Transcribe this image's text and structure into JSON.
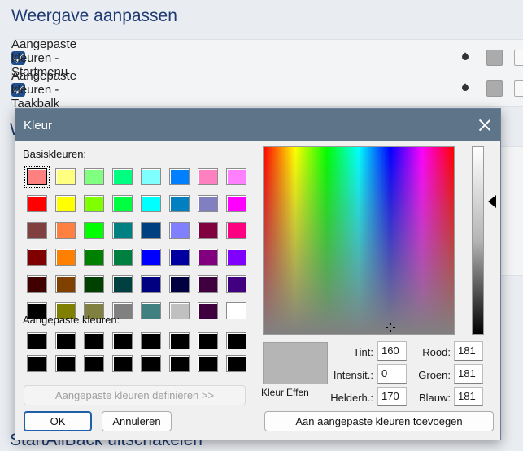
{
  "background": {
    "section_title": "Weergave aanpassen",
    "row1_label": "Aangepaste kleuren - Startmenu",
    "row2_label": "Aangepaste kleuren - Taakbalk",
    "partial_title": "W",
    "bottom_title": "StartAllBack uitschakelen"
  },
  "dialog": {
    "title": "Kleur",
    "basic_colors_label": "Basiskleuren:",
    "custom_colors_label": "Aangepaste kleuren:",
    "define_custom_button": "Aangepaste kleuren definiëren >>",
    "ok_button": "OK",
    "cancel_button": "Annuleren",
    "add_custom_button": "Aan aangepaste kleuren toevoegen",
    "preview_label_left": "Kleur",
    "preview_label_right": "Effen",
    "preview_color": "#b5b5b5",
    "fields": {
      "tint_label": "Tint:",
      "tint": "160",
      "sat_label": "Intensit.:",
      "sat": "0",
      "lum_label": "Helderh.:",
      "lum": "170",
      "red_label": "Rood:",
      "red": "181",
      "green_label": "Groen:",
      "green": "181",
      "blue_label": "Blauw:",
      "blue": "181"
    }
  },
  "basic_colors": [
    "#ff8080",
    "#ffff80",
    "#80ff80",
    "#00ff80",
    "#80ffff",
    "#0080ff",
    "#ff80c0",
    "#ff80ff",
    "#ff0000",
    "#ffff00",
    "#80ff00",
    "#00ff40",
    "#00ffff",
    "#0080c0",
    "#8080c0",
    "#ff00ff",
    "#804040",
    "#ff8040",
    "#00ff00",
    "#008080",
    "#004080",
    "#8080ff",
    "#800040",
    "#ff0080",
    "#800000",
    "#ff8000",
    "#008000",
    "#008040",
    "#0000ff",
    "#0000a0",
    "#800080",
    "#8000ff",
    "#400000",
    "#804000",
    "#004000",
    "#004040",
    "#000080",
    "#000040",
    "#400040",
    "#400080",
    "#000000",
    "#808000",
    "#808040",
    "#808080",
    "#408080",
    "#c0c0c0",
    "#400040",
    "#ffffff"
  ],
  "custom_colors": [
    "#000000",
    "#000000",
    "#000000",
    "#000000",
    "#000000",
    "#000000",
    "#000000",
    "#000000",
    "#000000",
    "#000000",
    "#000000",
    "#000000",
    "#000000",
    "#000000",
    "#000000",
    "#000000"
  ]
}
